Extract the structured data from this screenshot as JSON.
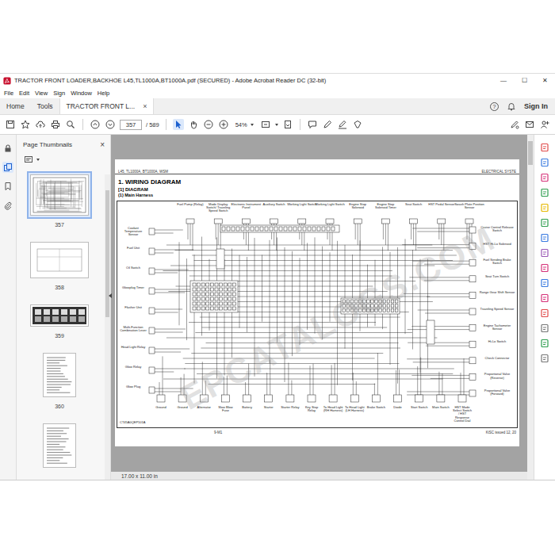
{
  "window": {
    "title": "TRACTOR FRONT LOADER,BACKHOE L45,TL1000A,BT1000A.pdf (SECURED) - Adobe Acrobat Reader DC (32-bit)",
    "controls": [
      "—",
      "☐",
      "✕"
    ]
  },
  "menu": [
    "File",
    "Edit",
    "View",
    "Sign",
    "Window",
    "Help"
  ],
  "tabs": [
    {
      "label": "Home",
      "selected": false
    },
    {
      "label": "Tools",
      "selected": false
    },
    {
      "label": "TRACTOR FRONT L...",
      "selected": true
    }
  ],
  "tab_close": "×",
  "help": "?",
  "sign_in": "Sign In",
  "toolbar": {
    "page": "357",
    "page_count": "/ 589",
    "zoom": "54%"
  },
  "thumbnails": {
    "title": "Page Thumbnails",
    "close": "×",
    "pages": [
      {
        "label": "357",
        "selected": true,
        "kind": "diagram"
      },
      {
        "label": "358",
        "selected": false,
        "kind": "sheet"
      },
      {
        "label": "359",
        "selected": false,
        "kind": "dark"
      },
      {
        "label": "360",
        "selected": false,
        "kind": "text"
      },
      {
        "label": "",
        "selected": false,
        "kind": "text"
      }
    ]
  },
  "page": {
    "header_left": "L45, TL1000A, BT1000A, WSM",
    "header_right": "ELECTRICAL SYSTE",
    "title": "1.  WIRING  DIAGRAM",
    "section": "[1]  DIAGRAM",
    "subsection": "(1)  Main Harness",
    "watermark": "EPCATALOGS.COM",
    "diagram": {
      "top": [
        "Fuel Pump (Relay)",
        "Mode Display Switch/ Traveling Speed Switch",
        "Electronic Instrument Panel",
        "Auxiliary Switch",
        "Working Light Switch",
        "Working Light Switch",
        "Engine Stop Solenoid",
        "Engine Stop Solenoid Timer",
        "Seat Switch",
        "HST Pedal Sensor",
        "Swash Plate Position Sensor"
      ],
      "left": [
        "Coolant Temperature Sensor",
        "Fuel Unit",
        "Oil Switch",
        "Glowplug Timer",
        "Flasher Unit",
        "Multi-Function Combination Lever",
        "Head Light Relay",
        "Glow Relay",
        "Glow Plug"
      ],
      "right": [
        "Cruise Control Release Switch",
        "HST Hi-Lo Solenoid",
        "Fuel Sending Brake Switch",
        "Seat Turn Switch",
        "Range Gear Shift Sensor",
        "Traveling Speed Sensor",
        "Engine Tachometer Sensor",
        "Hi-Lo Switch",
        "Check Connector",
        "Proportional Valve (Reverse)",
        "Proportional Valve (Forward)"
      ],
      "bottom": [
        "Ground",
        "Ground",
        "Alternator",
        "Slow Blow Fuse",
        "Battery",
        "Starter",
        "Starter Relay",
        "Key Stop Relay",
        "To Head Light (RH Harness)",
        "To Head Light (LH Harness)",
        "Brake Switch",
        "Diode",
        "Start Switch",
        "Main Switch",
        "HST Mode Select Switch / HST Response Control Dial"
      ],
      "code": "CT45A0QEP101A"
    },
    "footer_page": "9-M1",
    "footer_right": "KiSC issued 12, 20"
  },
  "status": "17.00 x 11.00 in"
}
